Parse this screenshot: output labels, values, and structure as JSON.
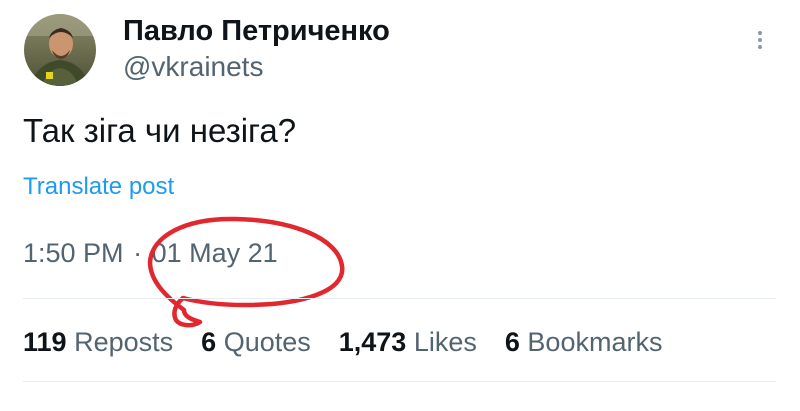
{
  "author": {
    "display_name": "Павло Петриченко",
    "handle": "@vkrainets"
  },
  "tweet": {
    "text": "Так зіга чи незіга?",
    "translate_label": "Translate post",
    "time": "1:50 PM",
    "separator": "·",
    "date": "01 May 21"
  },
  "stats": [
    {
      "value": "119",
      "label": "Reposts"
    },
    {
      "value": "6",
      "label": "Quotes"
    },
    {
      "value": "1,473",
      "label": "Likes"
    },
    {
      "value": "6",
      "label": "Bookmarks"
    }
  ],
  "icons": {
    "more": "more-vertical-icon"
  },
  "colors": {
    "text_primary": "#0f1419",
    "text_secondary": "#536471",
    "link": "#1d9bf0",
    "annotation": "#e0282e"
  }
}
